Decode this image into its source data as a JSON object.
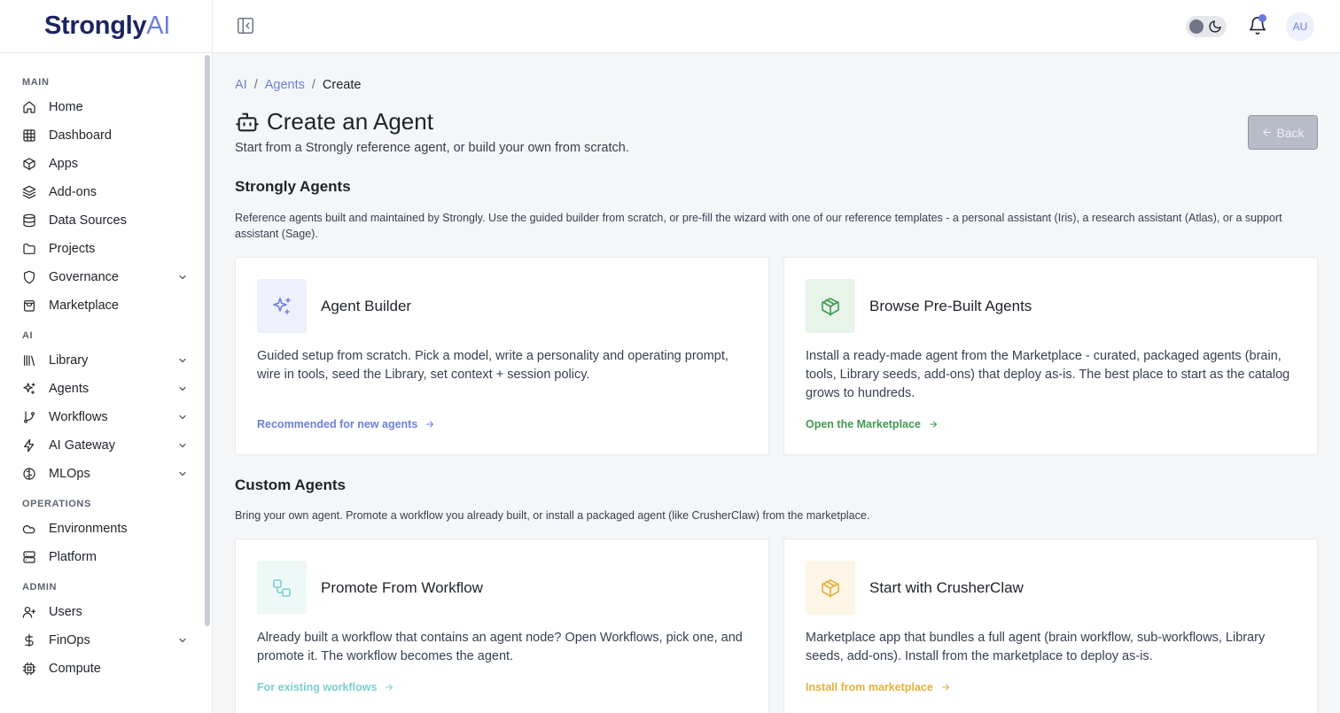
{
  "brand": {
    "name": "Strongly",
    "suffix": "AI"
  },
  "sidebar": {
    "sections": [
      {
        "label": "MAIN",
        "items": [
          {
            "label": "Home",
            "icon": "home-icon",
            "expandable": false
          },
          {
            "label": "Dashboard",
            "icon": "grid-icon",
            "expandable": false
          },
          {
            "label": "Apps",
            "icon": "box-icon",
            "expandable": false
          },
          {
            "label": "Add-ons",
            "icon": "layers-icon",
            "expandable": false
          },
          {
            "label": "Data Sources",
            "icon": "database-icon",
            "expandable": false
          },
          {
            "label": "Projects",
            "icon": "folder-icon",
            "expandable": false
          },
          {
            "label": "Governance",
            "icon": "shield-icon",
            "expandable": true
          },
          {
            "label": "Marketplace",
            "icon": "shopping-bag-icon",
            "expandable": false
          }
        ]
      },
      {
        "label": "AI",
        "items": [
          {
            "label": "Library",
            "icon": "library-icon",
            "expandable": true
          },
          {
            "label": "Agents",
            "icon": "sparkles-icon",
            "expandable": true
          },
          {
            "label": "Workflows",
            "icon": "git-branch-icon",
            "expandable": true
          },
          {
            "label": "AI Gateway",
            "icon": "zap-icon",
            "expandable": true
          },
          {
            "label": "MLOps",
            "icon": "brain-icon",
            "expandable": true
          }
        ]
      },
      {
        "label": "OPERATIONS",
        "items": [
          {
            "label": "Environments",
            "icon": "cloud-icon",
            "expandable": false
          },
          {
            "label": "Platform",
            "icon": "server-icon",
            "expandable": false
          }
        ]
      },
      {
        "label": "ADMIN",
        "items": [
          {
            "label": "Users",
            "icon": "user-plus-icon",
            "expandable": false
          },
          {
            "label": "FinOps",
            "icon": "dollar-icon",
            "expandable": true
          },
          {
            "label": "Compute",
            "icon": "cpu-icon",
            "expandable": false
          }
        ]
      }
    ]
  },
  "header": {
    "avatar_initials": "AU",
    "notification_dot": true
  },
  "breadcrumb": {
    "root": "AI",
    "parent": "Agents",
    "current": "Create",
    "sep": "/"
  },
  "page": {
    "title": "Create an Agent",
    "subtitle": "Start from a Strongly reference agent, or build your own from scratch.",
    "back_label": "Back"
  },
  "strongly_agents": {
    "title": "Strongly Agents",
    "description": "Reference agents built and maintained by Strongly. Use the guided builder from scratch, or pre-fill the wizard with one of our reference templates - a personal assistant (Iris), a research assistant (Atlas), or a support assistant (Sage).",
    "cards": [
      {
        "title": "Agent Builder",
        "description": "Guided setup from scratch. Pick a model, write a personality and operating prompt, wire in tools, seed the Library, set context + session policy.",
        "link": "Recommended for new agents",
        "icon": "sparkles-icon",
        "accent": "#6c7fd8",
        "bg": "#eef0fb"
      },
      {
        "title": "Browse Pre-Built Agents",
        "description": "Install a ready-made agent from the Marketplace - curated, packaged agents (brain, tools, Library seeds, add-ons) that deploy as-is. The best place to start as the catalog grows to hundreds.",
        "link": "Open the Marketplace",
        "icon": "package-icon",
        "accent": "#3f9a4f",
        "bg": "#e8f4ea"
      }
    ]
  },
  "custom_agents": {
    "title": "Custom Agents",
    "description": "Bring your own agent. Promote a workflow you already built, or install a packaged agent (like CrusherClaw) from the marketplace.",
    "cards": [
      {
        "title": "Promote From Workflow",
        "description": "Already built a workflow that contains an agent node? Open Workflows, pick one, and promote it. The workflow becomes the agent.",
        "link": "For existing workflows",
        "icon": "workflow-icon",
        "accent": "#7ccfd0",
        "bg": "#eef8f7"
      },
      {
        "title": "Start with CrusherClaw",
        "description": "Marketplace app that bundles a full agent (brain workflow, sub-workflows, Library seeds, add-ons). Install from the marketplace to deploy as-is.",
        "link": "Install from marketplace",
        "icon": "package-icon",
        "accent": "#e6b13c",
        "bg": "#fdf5e6"
      }
    ]
  }
}
